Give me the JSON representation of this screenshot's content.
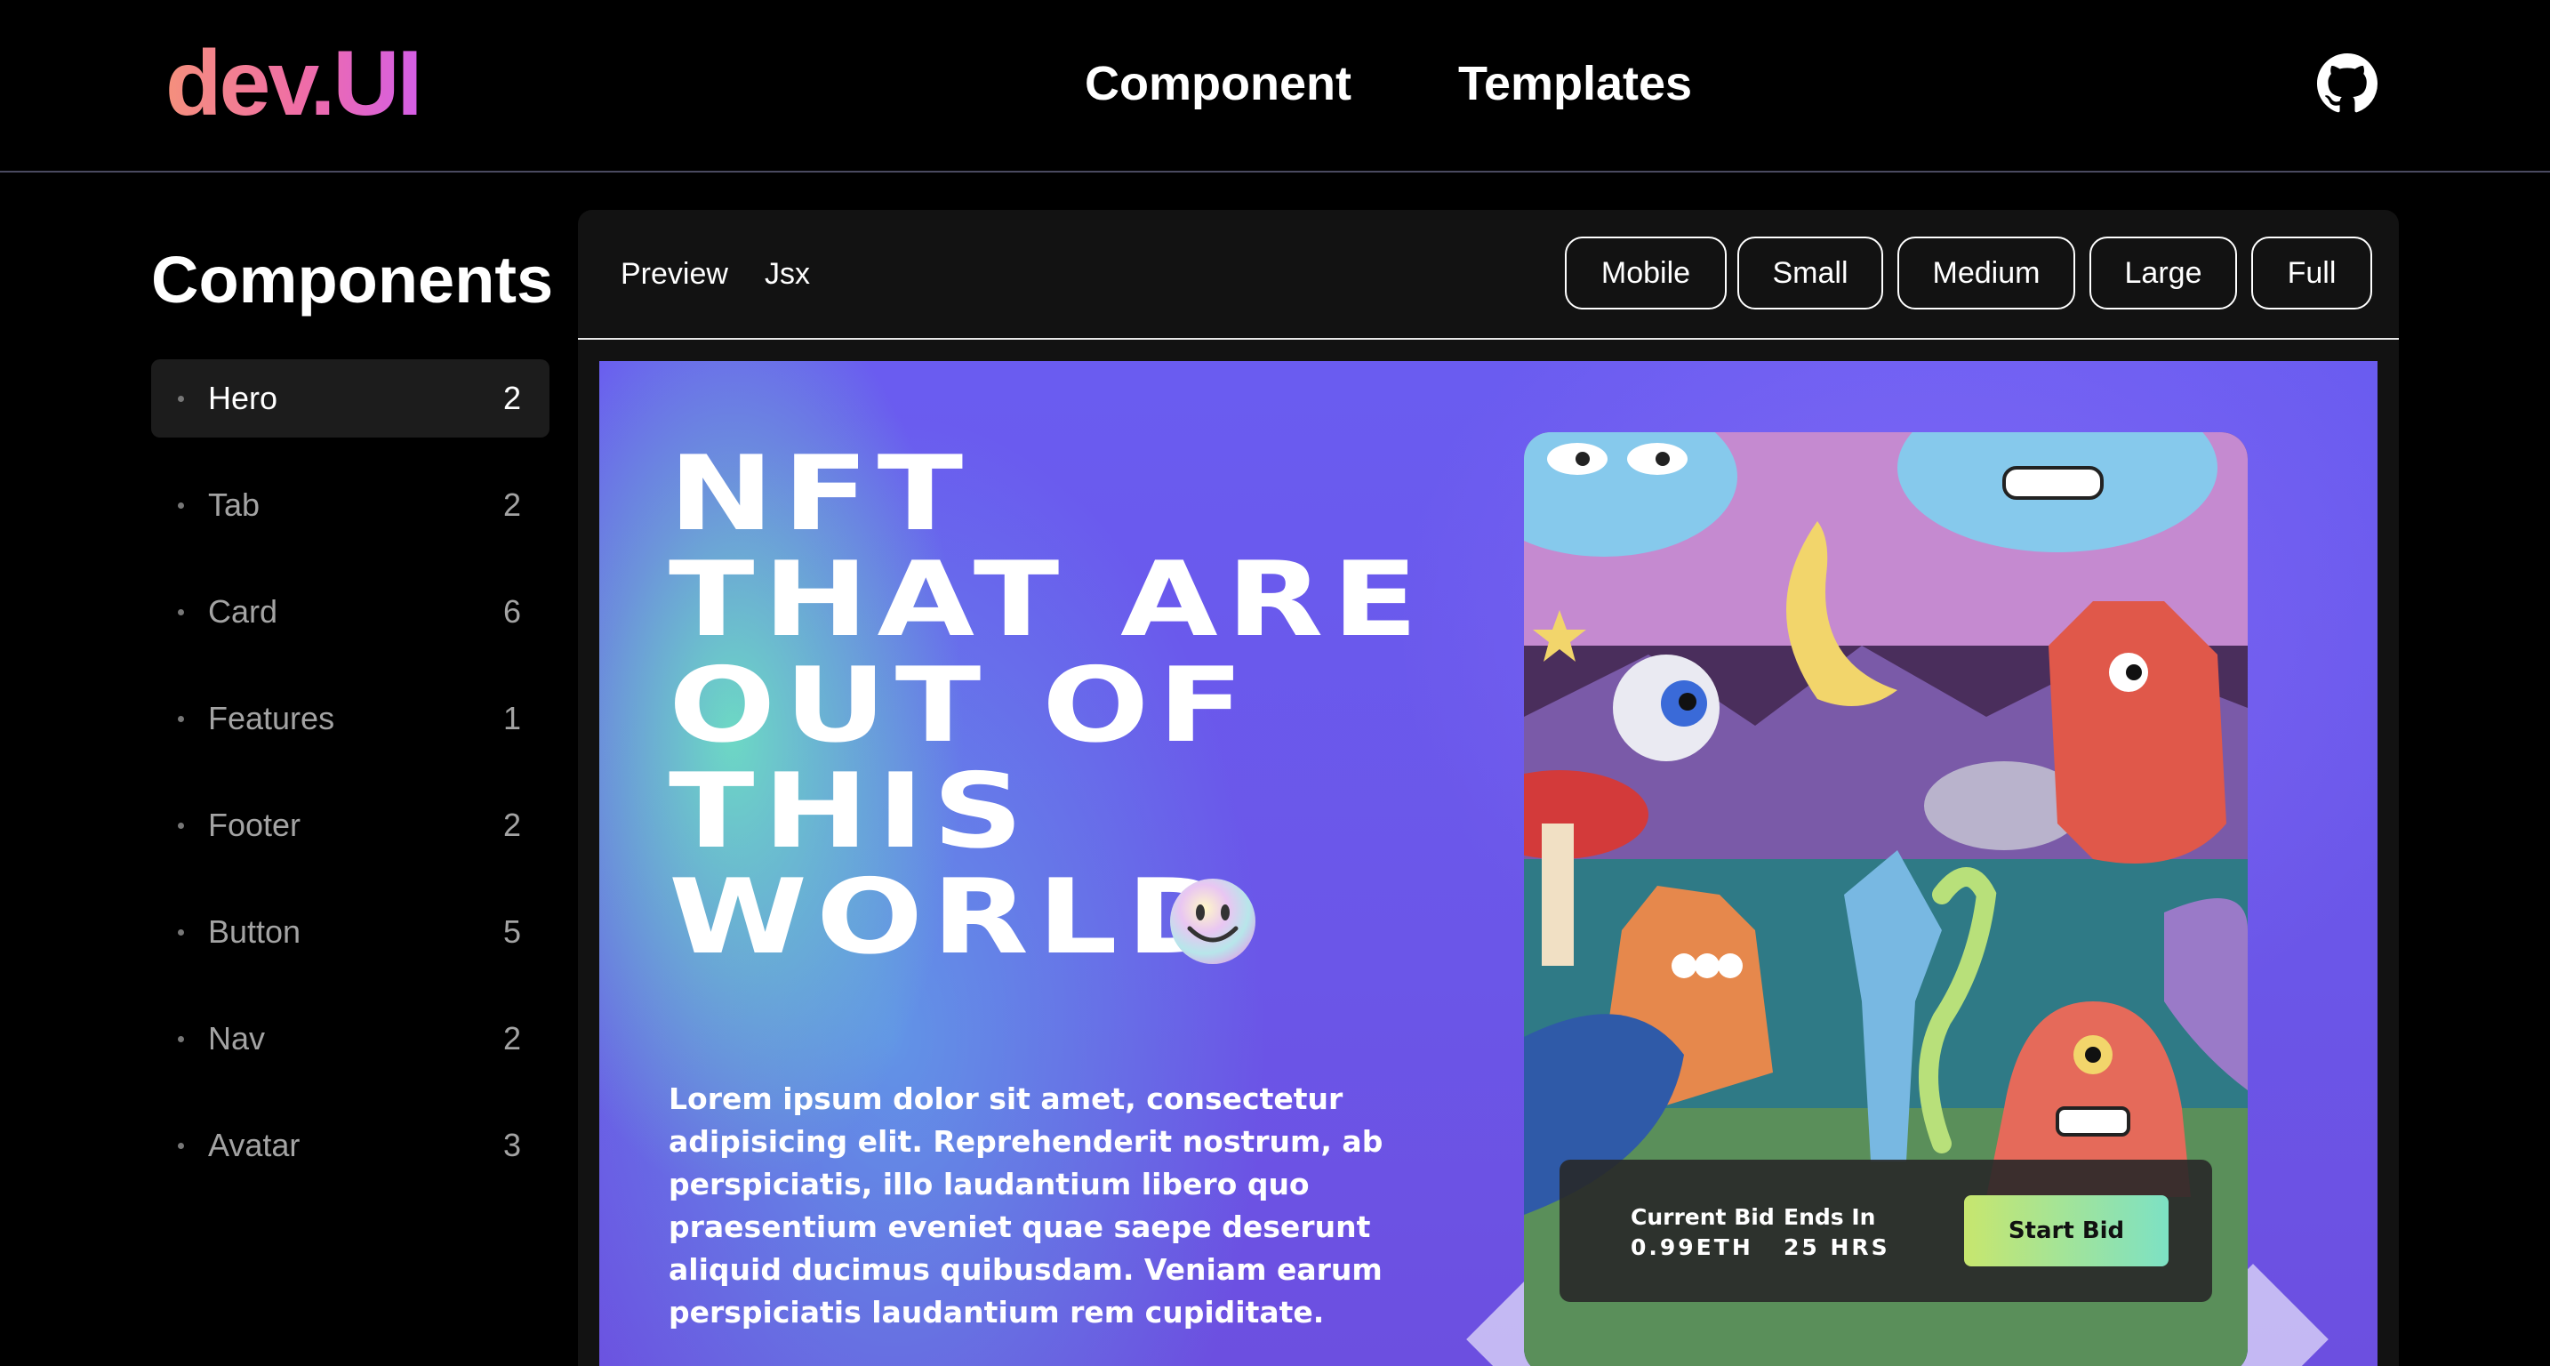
{
  "header": {
    "logo": "dev.UI",
    "nav": [
      {
        "label": "Component"
      },
      {
        "label": "Templates"
      }
    ],
    "github_icon": "github-icon"
  },
  "sidebar": {
    "title": "Components",
    "items": [
      {
        "label": "Hero",
        "count": "2",
        "active": true
      },
      {
        "label": "Tab",
        "count": "2"
      },
      {
        "label": "Card",
        "count": "6"
      },
      {
        "label": "Features",
        "count": "1"
      },
      {
        "label": "Footer",
        "count": "2"
      },
      {
        "label": "Button",
        "count": "5"
      },
      {
        "label": "Nav",
        "count": "2"
      },
      {
        "label": "Avatar",
        "count": "3"
      }
    ]
  },
  "panel": {
    "tabs": [
      {
        "label": "Preview"
      },
      {
        "label": "Jsx"
      }
    ],
    "sizes": [
      {
        "label": "Mobile"
      },
      {
        "label": "Small"
      },
      {
        "label": "Medium"
      },
      {
        "label": "Large"
      },
      {
        "label": "Full"
      }
    ]
  },
  "hero": {
    "headline": [
      "NFT",
      "THAT ARE",
      "OUT OF",
      "THIS",
      "WORLD"
    ],
    "paragraph": "Lorem ipsum dolor sit amet, consectetur adipisicing elit. Reprehenderit nostrum, ab perspiciatis, illo laudantium libero quo praesentium eveniet quae saepe deserunt aliquid ducimus quibusdam. Veniam earum perspiciatis laudantium rem cupiditate.",
    "bid": {
      "current_label": "Current Bid",
      "current_value": "0.99ETH",
      "ends_label": "Ends In",
      "ends_value": "25 HRS",
      "button": "Start Bid"
    }
  },
  "colors": {
    "logo_gradient": [
      "#f5907c",
      "#ef6ca8",
      "#d45ee6"
    ],
    "preview_bg": "#6b56e8",
    "accent_green": "#7de1c4"
  }
}
